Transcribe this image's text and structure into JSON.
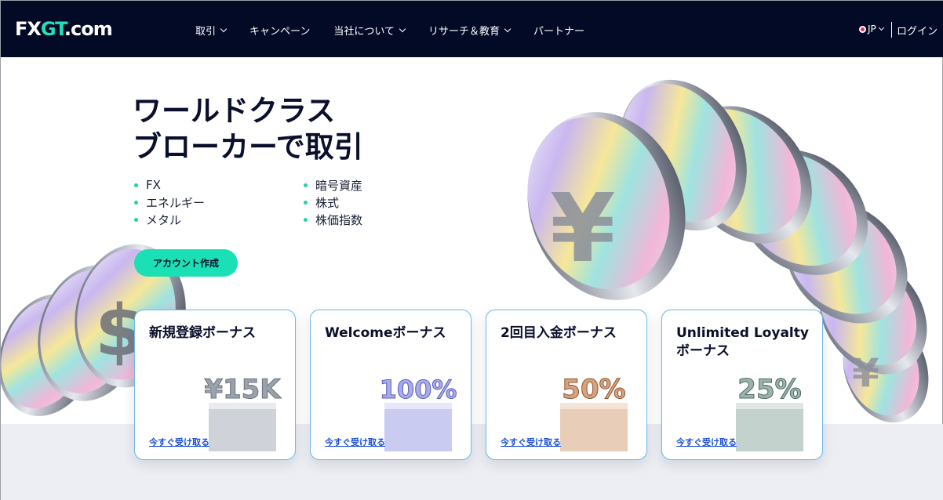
{
  "header": {
    "logo": {
      "prefix": "FX",
      "accent": "GT",
      "suffix": ".com"
    },
    "nav": [
      {
        "label": "取引",
        "has_dropdown": true
      },
      {
        "label": "キャンペーン",
        "has_dropdown": false
      },
      {
        "label": "当社について",
        "has_dropdown": true
      },
      {
        "label": "リサーチ＆教育",
        "has_dropdown": true
      },
      {
        "label": "パートナー",
        "has_dropdown": false
      }
    ],
    "language": "JP",
    "login": "ログイン"
  },
  "hero": {
    "title_line1": "ワールドクラス",
    "title_line2": "ブローカーで取引",
    "features": [
      "FX",
      "暗号資産",
      "エネルギー",
      "株式",
      "メタル",
      "株価指数"
    ],
    "cta": "アカウント作成"
  },
  "cards": [
    {
      "title": "新規登録ボーナス",
      "badge": "¥15K",
      "link": "今すぐ受け取る",
      "tint": "#9aa3ad"
    },
    {
      "title": "Welcomeボーナス",
      "badge": "100%",
      "link": "今すぐ受け取る",
      "tint": "#7d82d6"
    },
    {
      "title": "2回目入金ボーナス",
      "badge": "50%",
      "link": "今すぐ受け取る",
      "tint": "#c08a66"
    },
    {
      "title": "Unlimited Loyalty\nボーナス",
      "badge": "25%",
      "link": "今すぐ受け取る",
      "tint": "#6f8c86"
    }
  ],
  "colors": {
    "header_bg": "#020a26",
    "accent": "#1be0b5",
    "link": "#1b4fd8",
    "card_border": "#6fb8e8"
  }
}
